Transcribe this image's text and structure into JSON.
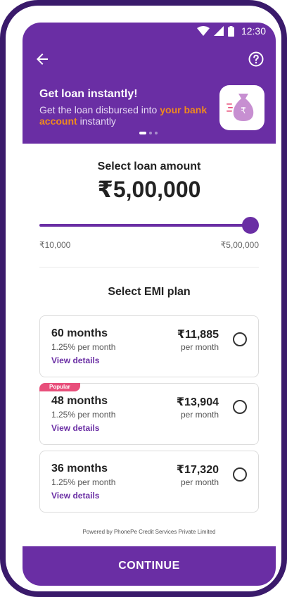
{
  "status_bar": {
    "time": "12:30"
  },
  "banner": {
    "title": "Get loan instantly!",
    "subtitle_prefix": "Get the loan disbursed into ",
    "subtitle_highlight": "your bank account",
    "subtitle_suffix": " instantly",
    "carousel_active": 0,
    "carousel_count": 3
  },
  "loan": {
    "label": "Select loan amount",
    "amount": "₹5,00,000",
    "min_label": "₹10,000",
    "max_label": "₹5,00,000",
    "slider_fraction": 1.0
  },
  "emi": {
    "label": "Select EMI plan",
    "plans": [
      {
        "months": "60 months",
        "rate": "1.25% per month",
        "details": "View details",
        "emi": "₹11,885",
        "per": "per month",
        "badge": ""
      },
      {
        "months": "48 months",
        "rate": "1.25% per month",
        "details": "View details",
        "emi": "₹13,904",
        "per": "per month",
        "badge": "Popular"
      },
      {
        "months": "36 months",
        "rate": "1.25% per month",
        "details": "View details",
        "emi": "₹17,320",
        "per": "per month",
        "badge": ""
      }
    ]
  },
  "footer": {
    "powered_by": "Powered by PhonePe Credit Services Private Limited",
    "continue_label": "CONTINUE"
  },
  "colors": {
    "primary": "#6a2ea4",
    "highlight": "#f08a1d",
    "badge": "#e84f7b"
  }
}
